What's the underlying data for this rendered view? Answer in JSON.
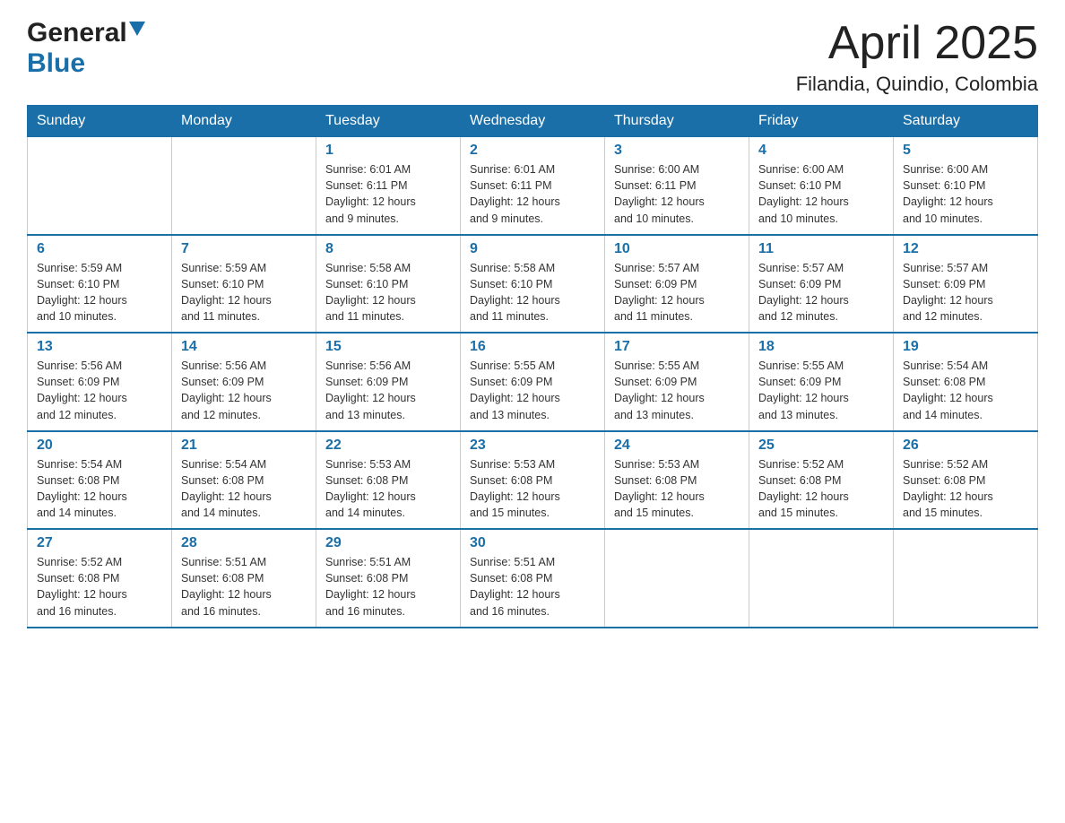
{
  "header": {
    "title": "April 2025",
    "subtitle": "Filandia, Quindio, Colombia",
    "logo_general": "General",
    "logo_blue": "Blue"
  },
  "weekdays": [
    "Sunday",
    "Monday",
    "Tuesday",
    "Wednesday",
    "Thursday",
    "Friday",
    "Saturday"
  ],
  "weeks": [
    [
      {
        "day": "",
        "info": ""
      },
      {
        "day": "",
        "info": ""
      },
      {
        "day": "1",
        "info": "Sunrise: 6:01 AM\nSunset: 6:11 PM\nDaylight: 12 hours\nand 9 minutes."
      },
      {
        "day": "2",
        "info": "Sunrise: 6:01 AM\nSunset: 6:11 PM\nDaylight: 12 hours\nand 9 minutes."
      },
      {
        "day": "3",
        "info": "Sunrise: 6:00 AM\nSunset: 6:11 PM\nDaylight: 12 hours\nand 10 minutes."
      },
      {
        "day": "4",
        "info": "Sunrise: 6:00 AM\nSunset: 6:10 PM\nDaylight: 12 hours\nand 10 minutes."
      },
      {
        "day": "5",
        "info": "Sunrise: 6:00 AM\nSunset: 6:10 PM\nDaylight: 12 hours\nand 10 minutes."
      }
    ],
    [
      {
        "day": "6",
        "info": "Sunrise: 5:59 AM\nSunset: 6:10 PM\nDaylight: 12 hours\nand 10 minutes."
      },
      {
        "day": "7",
        "info": "Sunrise: 5:59 AM\nSunset: 6:10 PM\nDaylight: 12 hours\nand 11 minutes."
      },
      {
        "day": "8",
        "info": "Sunrise: 5:58 AM\nSunset: 6:10 PM\nDaylight: 12 hours\nand 11 minutes."
      },
      {
        "day": "9",
        "info": "Sunrise: 5:58 AM\nSunset: 6:10 PM\nDaylight: 12 hours\nand 11 minutes."
      },
      {
        "day": "10",
        "info": "Sunrise: 5:57 AM\nSunset: 6:09 PM\nDaylight: 12 hours\nand 11 minutes."
      },
      {
        "day": "11",
        "info": "Sunrise: 5:57 AM\nSunset: 6:09 PM\nDaylight: 12 hours\nand 12 minutes."
      },
      {
        "day": "12",
        "info": "Sunrise: 5:57 AM\nSunset: 6:09 PM\nDaylight: 12 hours\nand 12 minutes."
      }
    ],
    [
      {
        "day": "13",
        "info": "Sunrise: 5:56 AM\nSunset: 6:09 PM\nDaylight: 12 hours\nand 12 minutes."
      },
      {
        "day": "14",
        "info": "Sunrise: 5:56 AM\nSunset: 6:09 PM\nDaylight: 12 hours\nand 12 minutes."
      },
      {
        "day": "15",
        "info": "Sunrise: 5:56 AM\nSunset: 6:09 PM\nDaylight: 12 hours\nand 13 minutes."
      },
      {
        "day": "16",
        "info": "Sunrise: 5:55 AM\nSunset: 6:09 PM\nDaylight: 12 hours\nand 13 minutes."
      },
      {
        "day": "17",
        "info": "Sunrise: 5:55 AM\nSunset: 6:09 PM\nDaylight: 12 hours\nand 13 minutes."
      },
      {
        "day": "18",
        "info": "Sunrise: 5:55 AM\nSunset: 6:09 PM\nDaylight: 12 hours\nand 13 minutes."
      },
      {
        "day": "19",
        "info": "Sunrise: 5:54 AM\nSunset: 6:08 PM\nDaylight: 12 hours\nand 14 minutes."
      }
    ],
    [
      {
        "day": "20",
        "info": "Sunrise: 5:54 AM\nSunset: 6:08 PM\nDaylight: 12 hours\nand 14 minutes."
      },
      {
        "day": "21",
        "info": "Sunrise: 5:54 AM\nSunset: 6:08 PM\nDaylight: 12 hours\nand 14 minutes."
      },
      {
        "day": "22",
        "info": "Sunrise: 5:53 AM\nSunset: 6:08 PM\nDaylight: 12 hours\nand 14 minutes."
      },
      {
        "day": "23",
        "info": "Sunrise: 5:53 AM\nSunset: 6:08 PM\nDaylight: 12 hours\nand 15 minutes."
      },
      {
        "day": "24",
        "info": "Sunrise: 5:53 AM\nSunset: 6:08 PM\nDaylight: 12 hours\nand 15 minutes."
      },
      {
        "day": "25",
        "info": "Sunrise: 5:52 AM\nSunset: 6:08 PM\nDaylight: 12 hours\nand 15 minutes."
      },
      {
        "day": "26",
        "info": "Sunrise: 5:52 AM\nSunset: 6:08 PM\nDaylight: 12 hours\nand 15 minutes."
      }
    ],
    [
      {
        "day": "27",
        "info": "Sunrise: 5:52 AM\nSunset: 6:08 PM\nDaylight: 12 hours\nand 16 minutes."
      },
      {
        "day": "28",
        "info": "Sunrise: 5:51 AM\nSunset: 6:08 PM\nDaylight: 12 hours\nand 16 minutes."
      },
      {
        "day": "29",
        "info": "Sunrise: 5:51 AM\nSunset: 6:08 PM\nDaylight: 12 hours\nand 16 minutes."
      },
      {
        "day": "30",
        "info": "Sunrise: 5:51 AM\nSunset: 6:08 PM\nDaylight: 12 hours\nand 16 minutes."
      },
      {
        "day": "",
        "info": ""
      },
      {
        "day": "",
        "info": ""
      },
      {
        "day": "",
        "info": ""
      }
    ]
  ]
}
